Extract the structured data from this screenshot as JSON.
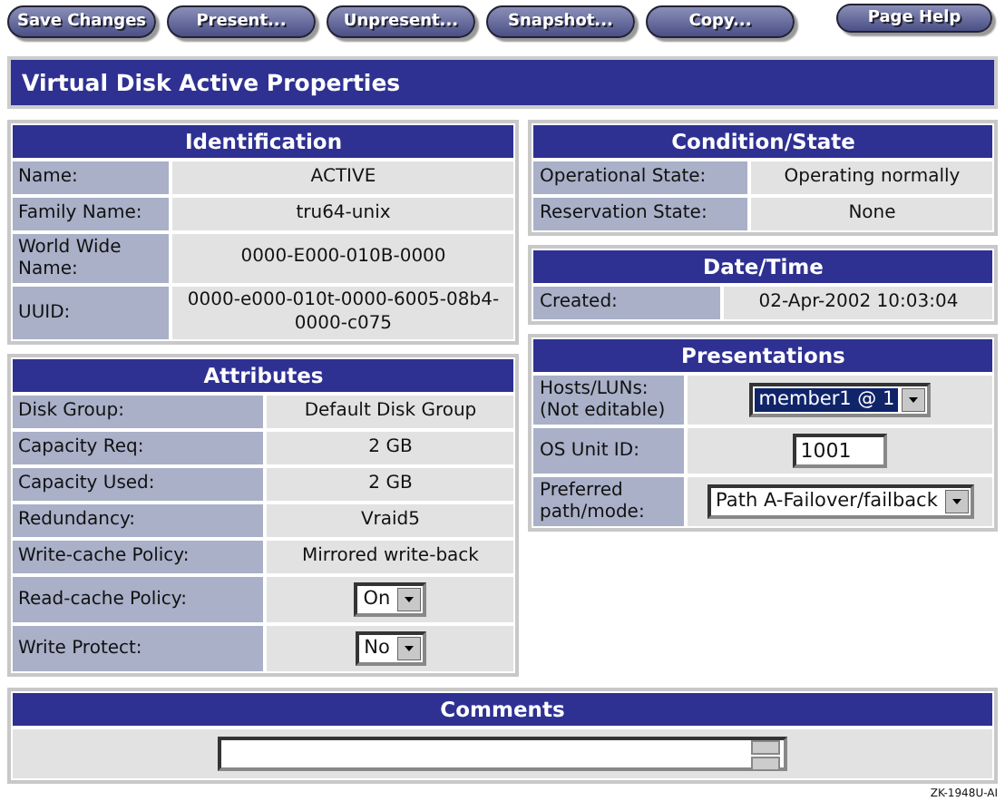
{
  "toolbar": [
    "Save Changes",
    "Present...",
    "Unpresent...",
    "Snapshot...",
    "Copy..."
  ],
  "help_button": "Page Help",
  "title": "Virtual Disk Active Properties",
  "left_sections": [
    {
      "title": "Identification",
      "rows": [
        {
          "label": "Name:",
          "kind": "text",
          "value": "ACTIVE"
        },
        {
          "label": "Family Name:",
          "kind": "text",
          "value": "tru64-unix"
        },
        {
          "label": "World Wide Name:",
          "kind": "text",
          "value": "0000-E000-010B-0000"
        },
        {
          "label": "UUID:",
          "kind": "text",
          "value": "0000-e000-010t-0000-6005-08b4-0000-c075"
        }
      ]
    },
    {
      "title": "Attributes",
      "rows": [
        {
          "label": "Disk Group:",
          "kind": "text",
          "value": "Default Disk Group"
        },
        {
          "label": "Capacity Req:",
          "kind": "text",
          "value": "2 GB"
        },
        {
          "label": "Capacity Used:",
          "kind": "text",
          "value": "2 GB"
        },
        {
          "label": "Redundancy:",
          "kind": "text",
          "value": "Vraid5"
        },
        {
          "label": "Write-cache Policy:",
          "kind": "text",
          "value": "Mirrored write-back"
        },
        {
          "label": "Read-cache Policy:",
          "kind": "select",
          "value": "On"
        },
        {
          "label": "Write Protect:",
          "kind": "select",
          "value": "No"
        }
      ]
    }
  ],
  "right_sections": [
    {
      "title": "Condition/State",
      "rows": [
        {
          "label": "Operational State:",
          "kind": "text",
          "value": "Operating normally"
        },
        {
          "label": "Reservation State:",
          "kind": "text",
          "value": "None"
        }
      ]
    },
    {
      "title": "Date/Time",
      "rows": [
        {
          "label": "Created:",
          "kind": "text",
          "value": "02-Apr-2002 10:03:04"
        }
      ]
    },
    {
      "title": "Presentations",
      "rows": [
        {
          "label": "Hosts/LUNs: (Not editable)",
          "kind": "select",
          "value": "member1 @ 1",
          "highlighted": true
        },
        {
          "label": "OS Unit ID:",
          "kind": "input",
          "value": "1001"
        },
        {
          "label": "Preferred path/mode:",
          "kind": "select",
          "value": "Path A-Failover/failback"
        }
      ]
    }
  ],
  "comments": {
    "title": "Comments"
  },
  "figure_code": "ZK-1948U-AI"
}
